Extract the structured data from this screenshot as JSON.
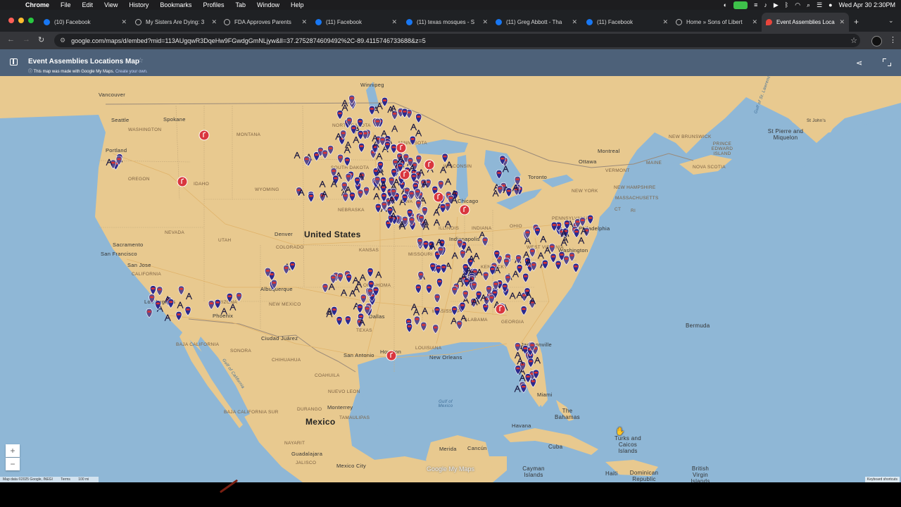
{
  "mac_menu": {
    "app": "Chrome",
    "items": [
      "File",
      "Edit",
      "View",
      "History",
      "Bookmarks",
      "Profiles",
      "Tab",
      "Window",
      "Help"
    ],
    "clock": "Wed Apr 30  2:30PM"
  },
  "tabs": [
    {
      "title": "(10) Facebook",
      "icon": "facebook-icon"
    },
    {
      "title": "My Sisters Are Dying: 3",
      "icon": "globe-icon"
    },
    {
      "title": "FDA Approves Parents",
      "icon": "globe-icon"
    },
    {
      "title": "(11) Facebook",
      "icon": "facebook-icon"
    },
    {
      "title": "(11) texas mosques - S",
      "icon": "facebook-icon"
    },
    {
      "title": "(11) Greg Abbott - Tha",
      "icon": "facebook-icon"
    },
    {
      "title": "(11) Facebook",
      "icon": "facebook-icon"
    },
    {
      "title": "Home » Sons of Libert",
      "icon": "globe-icon"
    },
    {
      "title": "Event Assemblies Loca",
      "icon": "maps-icon",
      "active": true
    }
  ],
  "address_bar": {
    "url": "google.com/maps/d/embed?mid=113AUgqwR3DqeHw9FGwdgGmNLjyw&ll=37.2752874609492%2C-89.4115746733688&z=5"
  },
  "map_header": {
    "title": "Event Assemblies Locations Map",
    "info": "This map was made with Google My Maps.",
    "info_link": "Create your own."
  },
  "map_labels": {
    "countries": [
      {
        "text": "United States",
        "style": "big"
      },
      {
        "text": "Mexico",
        "style": "big"
      }
    ],
    "cities": [
      "Vancouver",
      "Seattle",
      "Portland",
      "Winnipeg",
      "Spokane",
      "Sacramento",
      "San Francisco",
      "San Jose",
      "Los Angeles",
      "Phoenix",
      "Albuquerque",
      "Denver",
      "Ciudad Juárez",
      "San Antonio",
      "Houston",
      "Dallas",
      "Chicago",
      "Indianapolis",
      "Toronto",
      "Ottawa",
      "Montreal",
      "Philadelphia",
      "Washington",
      "Jacksonville",
      "Monterrey",
      "Havana",
      "Mexico City",
      "Guadalajara",
      "Merida",
      "Cancún",
      "Miami",
      "New Orleans"
    ],
    "states": [
      "WASHINGTON",
      "OREGON",
      "IDAHO",
      "MONTANA",
      "NORTH DAKOTA",
      "SOUTH DAKOTA",
      "WYOMING",
      "NEBRASKA",
      "NEVADA",
      "UTAH",
      "COLORADO",
      "CALIFORNIA",
      "ARIZONA",
      "NEW MEXICO",
      "KANSAS",
      "OKLAHOMA",
      "TEXAS",
      "MINNESOTA",
      "WISCONSIN",
      "IOWA",
      "ILLINOIS",
      "INDIANA",
      "OHIO",
      "MISSOURI",
      "MISSISSIPPI",
      "ALABAMA",
      "GEORGIA",
      "LOUISIANA",
      "WEST VIRGINIA",
      "KENTUCKY",
      "PENNSYLVANIA",
      "NEW YORK",
      "VERMONT",
      "NEW HAMPSHIRE",
      "MASSACHUSETTS",
      "MAINE",
      "CT",
      "RI",
      "NEW BRUNSWICK",
      "NOVA SCOTIA",
      "PRINCE EDWARD ISLAND",
      "BAJA CALIFORNIA",
      "BAJA CALIFORNIA SUR",
      "SONORA",
      "CHIHUAHUA",
      "COAHUILA",
      "NUEVO LEON",
      "TAMAULIPAS",
      "DURANGO",
      "JALISCO",
      "NAYARIT"
    ],
    "regions": [
      "St Pierre and Miquelon",
      "Bermuda",
      "The Bahamas",
      "Cuba",
      "Turks and Caicos Islands",
      "Cayman Islands",
      "Haiti",
      "Dominican Republic",
      "British Virgin Islands",
      "St John's"
    ],
    "water": [
      "Gulf of St. Lawrence",
      "Gulf of Mexico",
      "Gulf of California"
    ]
  },
  "map_footer": {
    "attribution": "Map data ©2025 Google, INEGI",
    "terms": "Terms",
    "scale": "100 mi",
    "shortcuts": "Keyboard shortcuts",
    "watermark": "Google My Maps"
  },
  "colors": {
    "map_header": "#4d6179",
    "land": "#e8c98f",
    "water": "#8fb7d6",
    "marker_red": "#d9363e",
    "marker_blue": "#2c2a8c"
  }
}
